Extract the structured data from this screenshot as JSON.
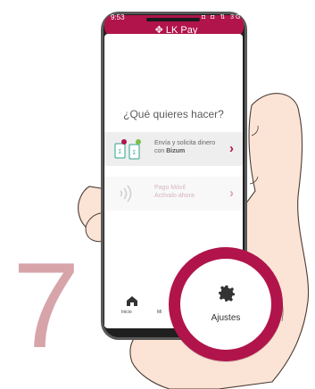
{
  "step": {
    "number": "7"
  },
  "status_bar": {
    "time": "9:53",
    "icons": "◘ ◘ ⇅ 3G ▮"
  },
  "app": {
    "title": "LK Pay"
  },
  "main": {
    "question": "¿Qué quieres hacer?",
    "cards": [
      {
        "title": "Envía y solicita dinero",
        "subtitle_prefix": "con ",
        "subtitle_strong": "Bizum",
        "icon": "bizum-icon"
      },
      {
        "title": "Pago Móvil",
        "subtitle": "Actívalo ahora",
        "icon": "contactless-icon"
      }
    ]
  },
  "tabbar": {
    "home_label": "Inicio",
    "middle_label": "Mi"
  },
  "magnifier": {
    "label": "Ajustes",
    "icon": "gear-icon"
  },
  "colors": {
    "brand": "#b1144b",
    "step": "#d7a4aa"
  }
}
